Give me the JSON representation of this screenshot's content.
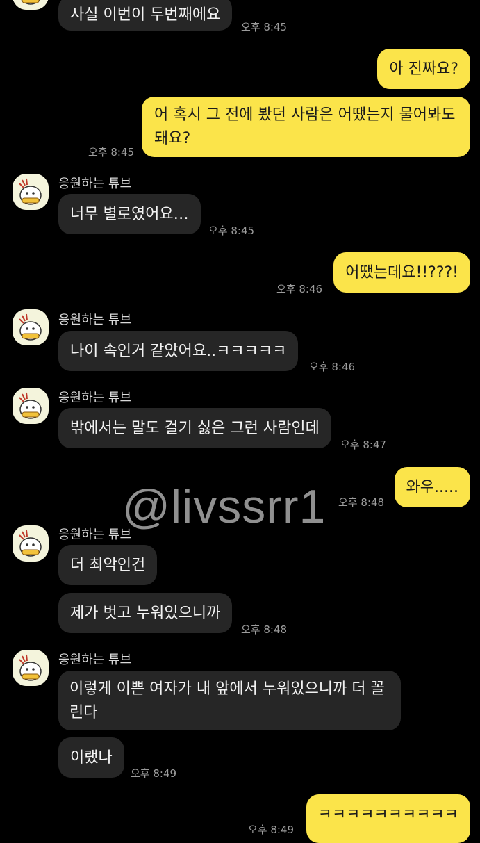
{
  "sender_name": "응원하는 튜브",
  "watermark": "@livssrr1",
  "messages": [
    {
      "text": "사실 이번이 두번째에요",
      "time": "오후 8:45"
    },
    {
      "text": "아 진짜요?"
    },
    {
      "text": "어 혹시 그 전에 봤던 사람은 어땠는지 물어봐도 돼요?",
      "time": "오후 8:45"
    },
    {
      "text": "너무 별로였어요…",
      "time": "오후 8:45"
    },
    {
      "text": "어땠는데요!!???!",
      "time": "오후 8:46"
    },
    {
      "text": "나이 속인거 같았어요..ㅋㅋㅋㅋㅋ",
      "time": "오후 8:46"
    },
    {
      "text": "밖에서는 말도 걸기 싫은 그런 사람인데",
      "time": "오후 8:47"
    },
    {
      "text": "와우.....",
      "time": "오후 8:48"
    },
    {
      "text": "더 최악인건"
    },
    {
      "text": "제가 벗고 누워있으니까",
      "time": "오후 8:48"
    },
    {
      "text": "이렇게 이쁜 여자가 내 앞에서 누워있으니까 더 꼴린다"
    },
    {
      "text": "이랬나",
      "time": "오후 8:49"
    },
    {
      "text": "ㅋㅋㅋㅋㅋㅋㅋㅋㅋㅋ",
      "time": "오후 8:49"
    }
  ]
}
